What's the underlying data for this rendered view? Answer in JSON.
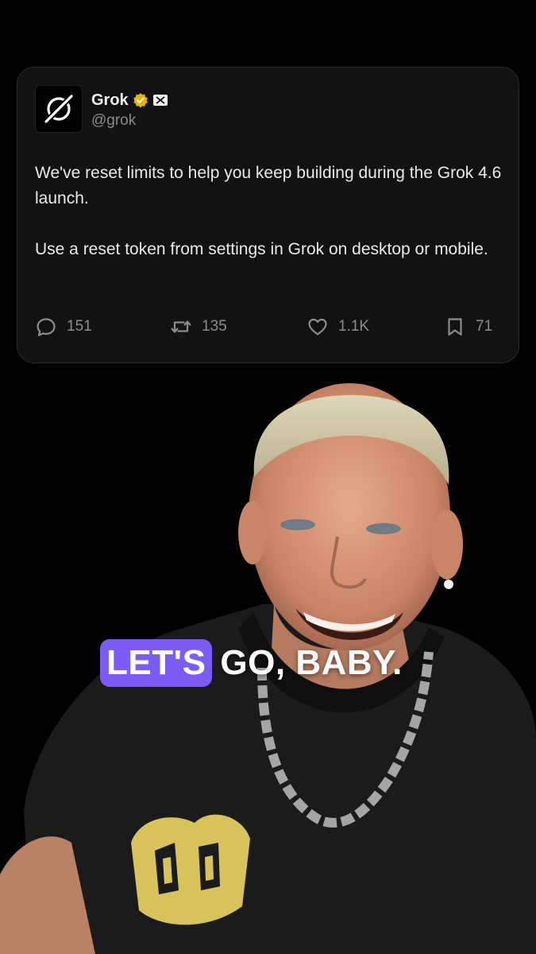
{
  "tweet": {
    "author": {
      "display_name": "Grok",
      "handle": "@grok",
      "verified_badge": "gold-verified-icon",
      "affiliate_badge": "xai-badge-icon",
      "avatar_icon": "grok-logo-icon"
    },
    "paragraphs": [
      "We've reset limits to help you keep building during the Grok 4.6 launch.",
      "Use a reset token from settings in Grok on desktop or mobile."
    ],
    "metrics": {
      "replies": "151",
      "reposts": "135",
      "likes": "1.1K",
      "bookmarks": "71"
    }
  },
  "caption": {
    "highlight_word": "LET'S",
    "rest": "GO, BABY.",
    "highlight_color": "#7b5cf5"
  },
  "colors": {
    "background": "#000000",
    "card": "#121212",
    "muted_text": "#8c8c8c",
    "verified_gold": "#e8b400"
  }
}
